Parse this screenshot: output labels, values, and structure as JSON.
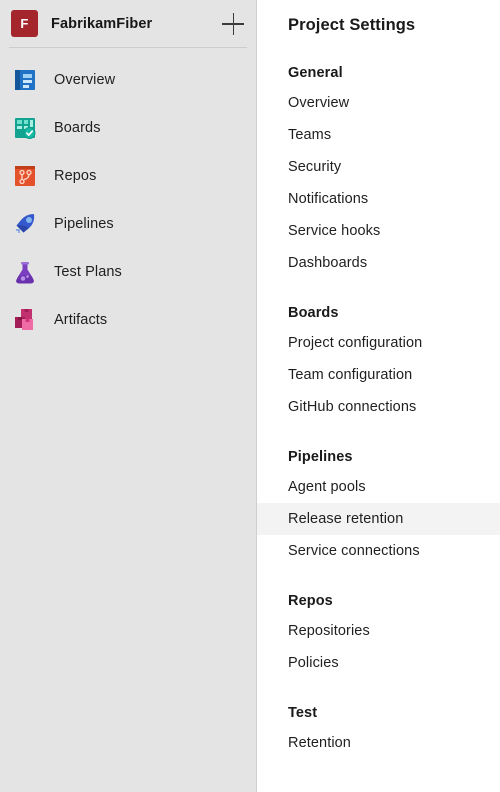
{
  "rail": {
    "project": {
      "initial": "F",
      "name": "FabrikamFiber",
      "badge_color": "#a4262c"
    },
    "new_button_label": "+",
    "items": [
      {
        "label": "Overview",
        "icon": "overview-icon",
        "color": "#1f72c6"
      },
      {
        "label": "Boards",
        "icon": "boards-icon",
        "color": "#12a391"
      },
      {
        "label": "Repos",
        "icon": "repos-icon",
        "color": "#e3522a"
      },
      {
        "label": "Pipelines",
        "icon": "pipelines-icon",
        "color": "#3559cd"
      },
      {
        "label": "Test Plans",
        "icon": "test-plans-icon",
        "color": "#7a3fc0"
      },
      {
        "label": "Artifacts",
        "icon": "artifacts-icon",
        "color": "#d1357f"
      }
    ]
  },
  "panel": {
    "title": "Project Settings",
    "groups": [
      {
        "header": "General",
        "items": [
          {
            "label": "Overview",
            "selected": false
          },
          {
            "label": "Teams",
            "selected": false
          },
          {
            "label": "Security",
            "selected": false
          },
          {
            "label": "Notifications",
            "selected": false
          },
          {
            "label": "Service hooks",
            "selected": false
          },
          {
            "label": "Dashboards",
            "selected": false
          }
        ]
      },
      {
        "header": "Boards",
        "items": [
          {
            "label": "Project configuration",
            "selected": false
          },
          {
            "label": "Team configuration",
            "selected": false
          },
          {
            "label": "GitHub connections",
            "selected": false
          }
        ]
      },
      {
        "header": "Pipelines",
        "items": [
          {
            "label": "Agent pools",
            "selected": false
          },
          {
            "label": "Release retention",
            "selected": true
          },
          {
            "label": "Service connections",
            "selected": false
          }
        ]
      },
      {
        "header": "Repos",
        "items": [
          {
            "label": "Repositories",
            "selected": false
          },
          {
            "label": "Policies",
            "selected": false
          }
        ]
      },
      {
        "header": "Test",
        "items": [
          {
            "label": "Retention",
            "selected": false
          }
        ]
      }
    ]
  },
  "colors": {
    "rail_background": "#e4e4e4",
    "rail_border": "#cfcfcf",
    "panel_background": "#ffffff",
    "selected_row": "#f3f3f3",
    "text": "#1f1f1f"
  }
}
